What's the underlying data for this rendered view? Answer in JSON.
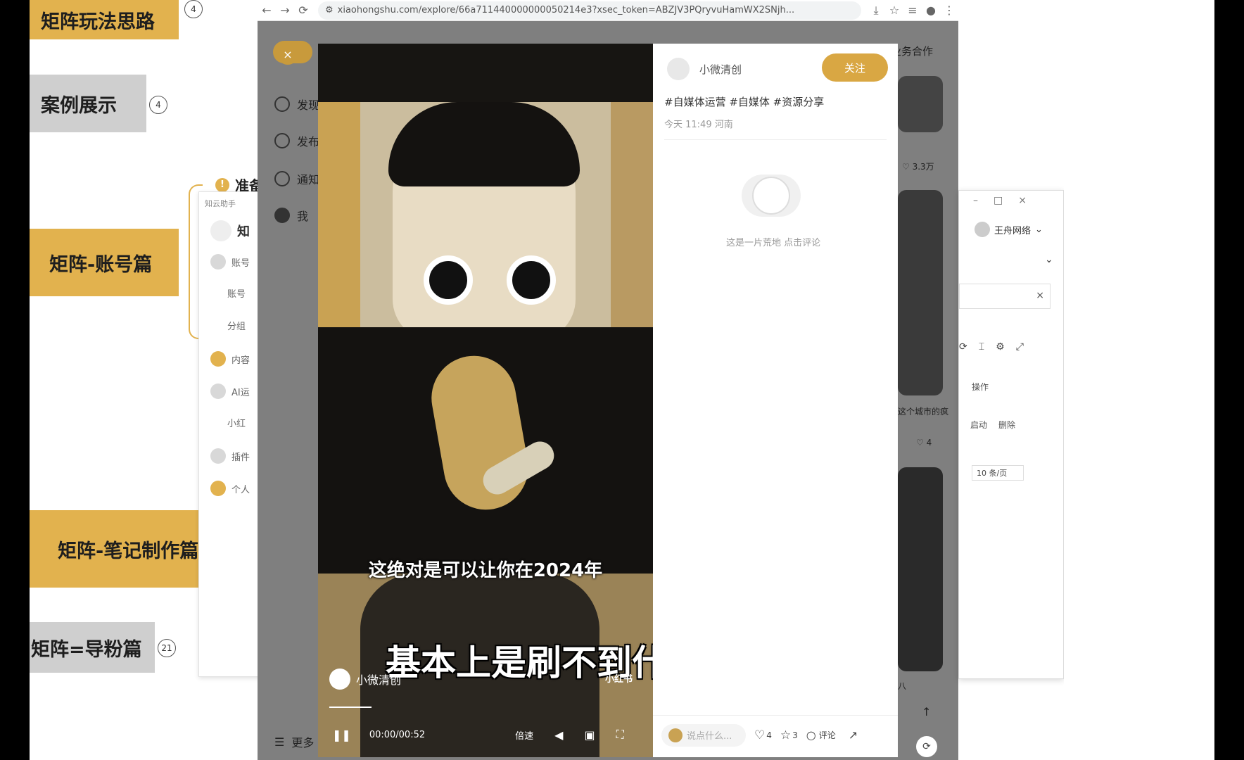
{
  "mindmap": {
    "nodes": [
      {
        "label": "矩阵玩法思路",
        "badge": "4"
      },
      {
        "label": "案例展示",
        "badge": "4"
      },
      {
        "label": "矩阵-账号篇",
        "badge": ""
      },
      {
        "label": "矩阵-笔记制作篇",
        "badge": ""
      },
      {
        "label": "矩阵=导粉篇",
        "badge": "21"
      }
    ],
    "partial_label": "准备"
  },
  "tool_panel": {
    "title": "知云助手",
    "header": "知",
    "items": [
      "账号",
      "账号",
      "分组",
      "内容",
      "AI运",
      "小红",
      "插件",
      "个人"
    ]
  },
  "browser": {
    "url": "xiaohongshu.com/explore/66a711440000000050214e3?xsec_token=ABZJV3PQryvuHamWX2SNjh..."
  },
  "xhs_sidebar": {
    "items": [
      "发现",
      "发布",
      "通知",
      "我"
    ],
    "more": "更多",
    "top_right": "业务合作"
  },
  "feed": {
    "likes": [
      "3.3万",
      "4"
    ],
    "snippet": "这个城市的疯",
    "snippet2": "八"
  },
  "video": {
    "subtitle_small": "这绝对是可以让你在2024年",
    "subtitle_big": "基本上是刷不到什么内容的啊",
    "watermark_author": "小微清创",
    "watermark_brand": "小红书",
    "time": "00:00/00:52",
    "speed": "倍速"
  },
  "note": {
    "author": "小微清创",
    "follow": "关注",
    "tags": "#自媒体运营 #自媒体 #资源分享",
    "time": "今天 11:49 河南",
    "empty_comment": "这是一片荒地 点击评论",
    "comment_placeholder": "说点什么...",
    "likes": "4",
    "collects": "3",
    "comments": "评论"
  },
  "side_window": {
    "user": "王舟网络",
    "toolbar_label": "操作",
    "actions": [
      "启动",
      "删除"
    ],
    "page_size": "10 条/页"
  }
}
